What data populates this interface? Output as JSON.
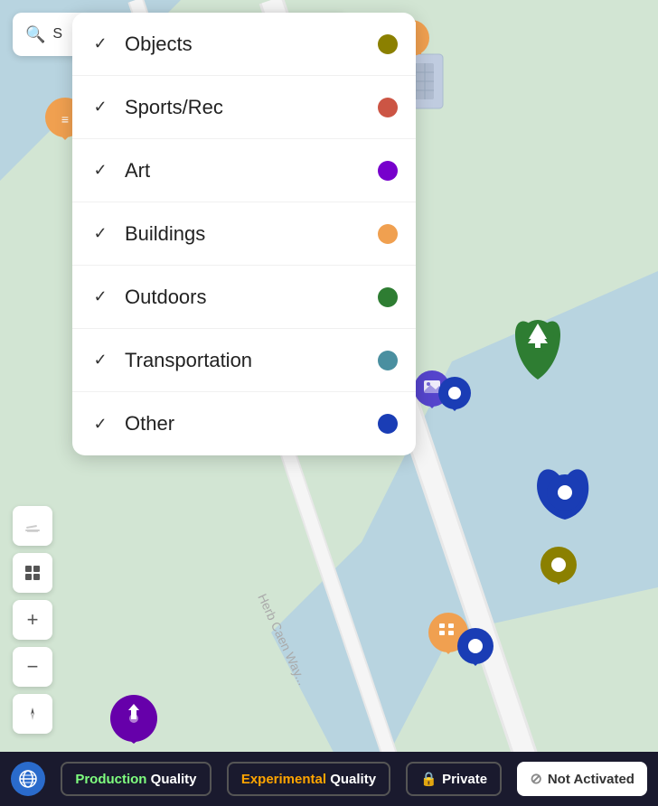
{
  "map": {
    "background_color": "#b8d4e0"
  },
  "search": {
    "placeholder": "S",
    "icon": "🔍"
  },
  "filter_menu": {
    "items": [
      {
        "label": "Objects",
        "checked": true,
        "color": "#7a7a00",
        "dot_color": "#8b8000"
      },
      {
        "label": "Sports/Rec",
        "checked": true,
        "color": "#cc5544",
        "dot_color": "#cc5544"
      },
      {
        "label": "Art",
        "checked": true,
        "color": "#7700cc",
        "dot_color": "#7700cc"
      },
      {
        "label": "Buildings",
        "checked": true,
        "color": "#f0a050",
        "dot_color": "#f0a050"
      },
      {
        "label": "Outdoors",
        "checked": true,
        "color": "#2e7d32",
        "dot_color": "#2e7d32"
      },
      {
        "label": "Transportation",
        "checked": true,
        "color": "#4a8fa0",
        "dot_color": "#4a8fa0"
      },
      {
        "label": "Other",
        "checked": true,
        "color": "#1a3db5",
        "dot_color": "#1a3db5"
      }
    ]
  },
  "toolbar": {
    "buttons": [
      {
        "icon": "✏️",
        "name": "edit",
        "label": "Edit"
      },
      {
        "icon": "⊞",
        "name": "grid",
        "label": "Grid"
      },
      {
        "icon": "+",
        "name": "zoom-in",
        "label": "Zoom In"
      },
      {
        "icon": "−",
        "name": "zoom-out",
        "label": "Zoom Out"
      },
      {
        "icon": "▲",
        "name": "compass",
        "label": "Compass"
      }
    ]
  },
  "bottom_bar": {
    "production_prefix": "Production",
    "production_suffix": "Quality",
    "experimental_prefix": "Experimental",
    "experimental_suffix": "Quality",
    "private_label": "Private",
    "not_activated_label": "Not Activated",
    "lock_icon": "🔒",
    "slash_icon": "⊘"
  }
}
